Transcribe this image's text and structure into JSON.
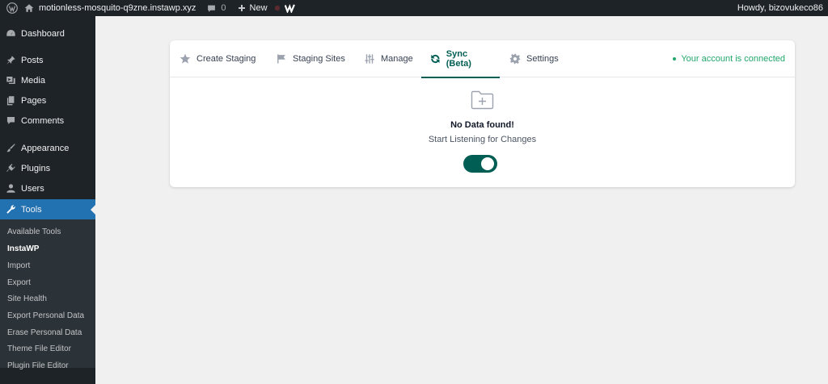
{
  "adminbar": {
    "site_name": "motionless-mosquito-q9zne.instawp.xyz",
    "comments_count": "0",
    "new_label": "New",
    "howdy": "Howdy, bizovukeco86"
  },
  "sidebar": {
    "items": [
      {
        "label": "Dashboard",
        "icon": "dashboard-icon"
      },
      {
        "label": "Posts",
        "icon": "pin-icon"
      },
      {
        "label": "Media",
        "icon": "media-icon"
      },
      {
        "label": "Pages",
        "icon": "pages-icon"
      },
      {
        "label": "Comments",
        "icon": "comment-icon"
      },
      {
        "label": "Appearance",
        "icon": "brush-icon"
      },
      {
        "label": "Plugins",
        "icon": "plug-icon"
      },
      {
        "label": "Users",
        "icon": "user-icon"
      },
      {
        "label": "Tools",
        "icon": "wrench-icon"
      }
    ],
    "submenu": [
      "Available Tools",
      "InstaWP",
      "Import",
      "Export",
      "Site Health",
      "Export Personal Data",
      "Erase Personal Data",
      "Theme File Editor",
      "Plugin File Editor"
    ]
  },
  "tabs": [
    {
      "label": "Create Staging",
      "icon": "star-icon"
    },
    {
      "label": "Staging Sites",
      "icon": "flag-icon"
    },
    {
      "label": "Manage",
      "icon": "sliders-icon"
    },
    {
      "label": "Sync (Beta)",
      "icon": "sync-icon"
    },
    {
      "label": "Settings",
      "icon": "gear-icon"
    }
  ],
  "active_tab": "Sync (Beta)",
  "connection_status": "Your account is connected",
  "empty_state": {
    "title": "No Data found!",
    "subtitle": "Start Listening for Changes",
    "toggle_on": true
  },
  "colors": {
    "accent": "#005e54",
    "connected": "#22a66b",
    "wp_active": "#2271b1"
  }
}
